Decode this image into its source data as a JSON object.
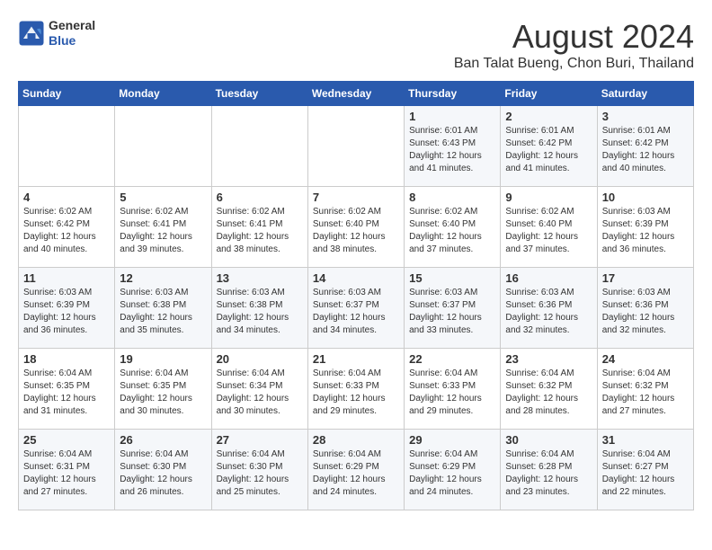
{
  "header": {
    "logo_general": "General",
    "logo_blue": "Blue",
    "month_year": "August 2024",
    "location": "Ban Talat Bueng, Chon Buri, Thailand"
  },
  "days_of_week": [
    "Sunday",
    "Monday",
    "Tuesday",
    "Wednesday",
    "Thursday",
    "Friday",
    "Saturday"
  ],
  "weeks": [
    [
      {
        "num": "",
        "info": ""
      },
      {
        "num": "",
        "info": ""
      },
      {
        "num": "",
        "info": ""
      },
      {
        "num": "",
        "info": ""
      },
      {
        "num": "1",
        "info": "Sunrise: 6:01 AM\nSunset: 6:43 PM\nDaylight: 12 hours\nand 41 minutes."
      },
      {
        "num": "2",
        "info": "Sunrise: 6:01 AM\nSunset: 6:42 PM\nDaylight: 12 hours\nand 41 minutes."
      },
      {
        "num": "3",
        "info": "Sunrise: 6:01 AM\nSunset: 6:42 PM\nDaylight: 12 hours\nand 40 minutes."
      }
    ],
    [
      {
        "num": "4",
        "info": "Sunrise: 6:02 AM\nSunset: 6:42 PM\nDaylight: 12 hours\nand 40 minutes."
      },
      {
        "num": "5",
        "info": "Sunrise: 6:02 AM\nSunset: 6:41 PM\nDaylight: 12 hours\nand 39 minutes."
      },
      {
        "num": "6",
        "info": "Sunrise: 6:02 AM\nSunset: 6:41 PM\nDaylight: 12 hours\nand 38 minutes."
      },
      {
        "num": "7",
        "info": "Sunrise: 6:02 AM\nSunset: 6:40 PM\nDaylight: 12 hours\nand 38 minutes."
      },
      {
        "num": "8",
        "info": "Sunrise: 6:02 AM\nSunset: 6:40 PM\nDaylight: 12 hours\nand 37 minutes."
      },
      {
        "num": "9",
        "info": "Sunrise: 6:02 AM\nSunset: 6:40 PM\nDaylight: 12 hours\nand 37 minutes."
      },
      {
        "num": "10",
        "info": "Sunrise: 6:03 AM\nSunset: 6:39 PM\nDaylight: 12 hours\nand 36 minutes."
      }
    ],
    [
      {
        "num": "11",
        "info": "Sunrise: 6:03 AM\nSunset: 6:39 PM\nDaylight: 12 hours\nand 36 minutes."
      },
      {
        "num": "12",
        "info": "Sunrise: 6:03 AM\nSunset: 6:38 PM\nDaylight: 12 hours\nand 35 minutes."
      },
      {
        "num": "13",
        "info": "Sunrise: 6:03 AM\nSunset: 6:38 PM\nDaylight: 12 hours\nand 34 minutes."
      },
      {
        "num": "14",
        "info": "Sunrise: 6:03 AM\nSunset: 6:37 PM\nDaylight: 12 hours\nand 34 minutes."
      },
      {
        "num": "15",
        "info": "Sunrise: 6:03 AM\nSunset: 6:37 PM\nDaylight: 12 hours\nand 33 minutes."
      },
      {
        "num": "16",
        "info": "Sunrise: 6:03 AM\nSunset: 6:36 PM\nDaylight: 12 hours\nand 32 minutes."
      },
      {
        "num": "17",
        "info": "Sunrise: 6:03 AM\nSunset: 6:36 PM\nDaylight: 12 hours\nand 32 minutes."
      }
    ],
    [
      {
        "num": "18",
        "info": "Sunrise: 6:04 AM\nSunset: 6:35 PM\nDaylight: 12 hours\nand 31 minutes."
      },
      {
        "num": "19",
        "info": "Sunrise: 6:04 AM\nSunset: 6:35 PM\nDaylight: 12 hours\nand 30 minutes."
      },
      {
        "num": "20",
        "info": "Sunrise: 6:04 AM\nSunset: 6:34 PM\nDaylight: 12 hours\nand 30 minutes."
      },
      {
        "num": "21",
        "info": "Sunrise: 6:04 AM\nSunset: 6:33 PM\nDaylight: 12 hours\nand 29 minutes."
      },
      {
        "num": "22",
        "info": "Sunrise: 6:04 AM\nSunset: 6:33 PM\nDaylight: 12 hours\nand 29 minutes."
      },
      {
        "num": "23",
        "info": "Sunrise: 6:04 AM\nSunset: 6:32 PM\nDaylight: 12 hours\nand 28 minutes."
      },
      {
        "num": "24",
        "info": "Sunrise: 6:04 AM\nSunset: 6:32 PM\nDaylight: 12 hours\nand 27 minutes."
      }
    ],
    [
      {
        "num": "25",
        "info": "Sunrise: 6:04 AM\nSunset: 6:31 PM\nDaylight: 12 hours\nand 27 minutes."
      },
      {
        "num": "26",
        "info": "Sunrise: 6:04 AM\nSunset: 6:30 PM\nDaylight: 12 hours\nand 26 minutes."
      },
      {
        "num": "27",
        "info": "Sunrise: 6:04 AM\nSunset: 6:30 PM\nDaylight: 12 hours\nand 25 minutes."
      },
      {
        "num": "28",
        "info": "Sunrise: 6:04 AM\nSunset: 6:29 PM\nDaylight: 12 hours\nand 24 minutes."
      },
      {
        "num": "29",
        "info": "Sunrise: 6:04 AM\nSunset: 6:29 PM\nDaylight: 12 hours\nand 24 minutes."
      },
      {
        "num": "30",
        "info": "Sunrise: 6:04 AM\nSunset: 6:28 PM\nDaylight: 12 hours\nand 23 minutes."
      },
      {
        "num": "31",
        "info": "Sunrise: 6:04 AM\nSunset: 6:27 PM\nDaylight: 12 hours\nand 22 minutes."
      }
    ]
  ]
}
